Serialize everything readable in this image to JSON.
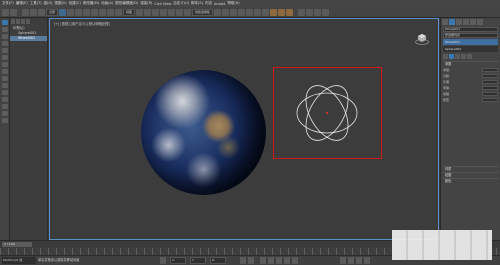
{
  "menubar": {
    "items": [
      "文件(F)",
      "编辑(E)",
      "工具(T)",
      "组(G)",
      "视图(V)",
      "创建(C)",
      "修改器(M)",
      "动画(A)",
      "图形编辑器(D)",
      "渲染(R)",
      "Civil View",
      "自定义(U)",
      "脚本(S)",
      "内容",
      "Arnold",
      "帮助(H)"
    ]
  },
  "toolbar": {
    "selection_filter": "全部",
    "view_dropdown": "视图",
    "named_selection": "创建选择集"
  },
  "explorer": {
    "root": "0(默认)",
    "items": [
      "Sphere001",
      "Wheel001"
    ],
    "selected_index": 1
  },
  "viewport": {
    "label": "[+] [透视] [用户定义] [默认明暗处理]"
  },
  "cmdpanel": {
    "object_name": "Wheel001",
    "modifier_list": "修改器列表",
    "stack_items": [
      "Wheel001",
      "Sphere001"
    ],
    "rollout_params": "参数",
    "props": [
      {
        "label": "半径:"
      },
      {
        "label": "分段:"
      },
      {
        "label": "平滑"
      },
      {
        "label": "半球:"
      },
      {
        "label": "切除"
      },
      {
        "label": "挤压"
      }
    ],
    "rollouts_bottom": [
      "材质",
      "贴图",
      "颜色"
    ]
  },
  "timeline": {
    "slider": "0 / 100"
  },
  "statusbar": {
    "script": "MAXScript 迷",
    "message": "单击并拖动以选择并移动对象",
    "x": "X:",
    "y": "Y:",
    "z": "Z:"
  }
}
